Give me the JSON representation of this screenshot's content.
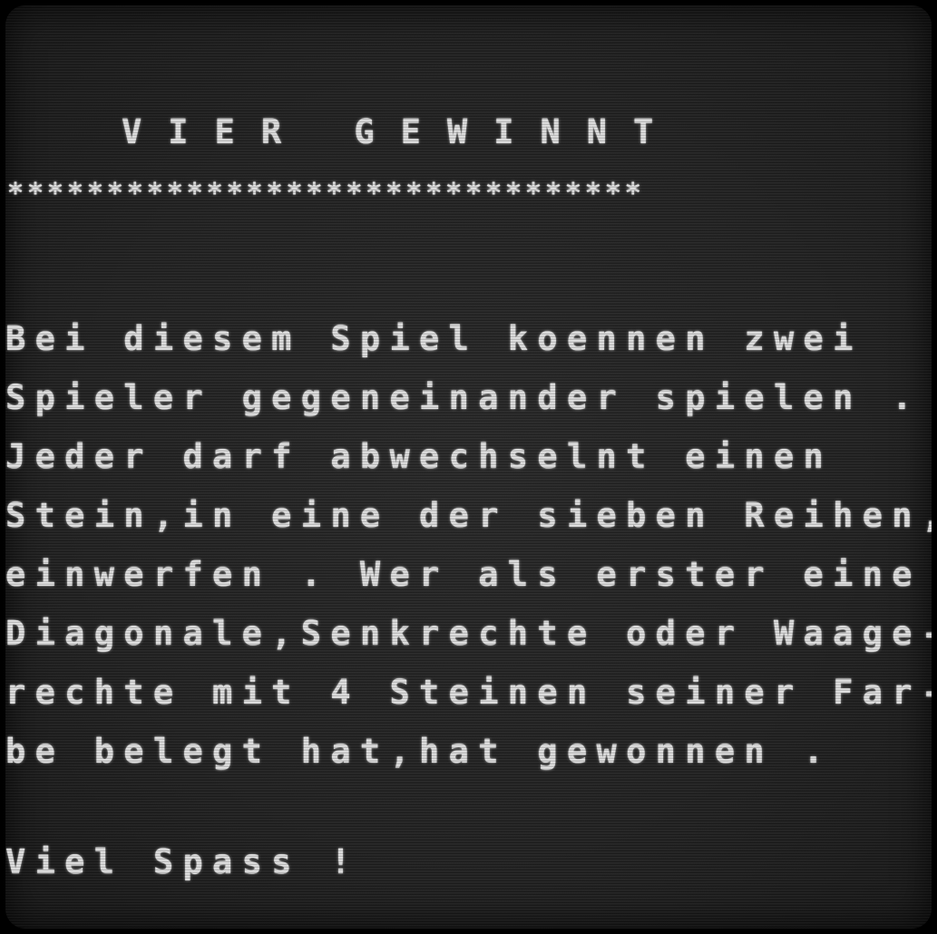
{
  "screen": {
    "title": "VIER GEWINNT",
    "separator": "********************************",
    "instructions": [
      "Bei diesem Spiel koennen zwei",
      "Spieler gegeneinander spielen .",
      "Jeder darf abwechselnt einen",
      "Stein,in eine der sieben Reihen,",
      "einwerfen . Wer als erster eine",
      "Diagonale,Senkrechte oder Waage-",
      "rechte mit 4 Steinen seiner Far-",
      "be belegt hat,hat gewonnen ."
    ],
    "farewell": "Viel Spass !"
  },
  "colors": {
    "text": "#e4e4e4",
    "background": "#232323",
    "bezel": "#000000"
  }
}
